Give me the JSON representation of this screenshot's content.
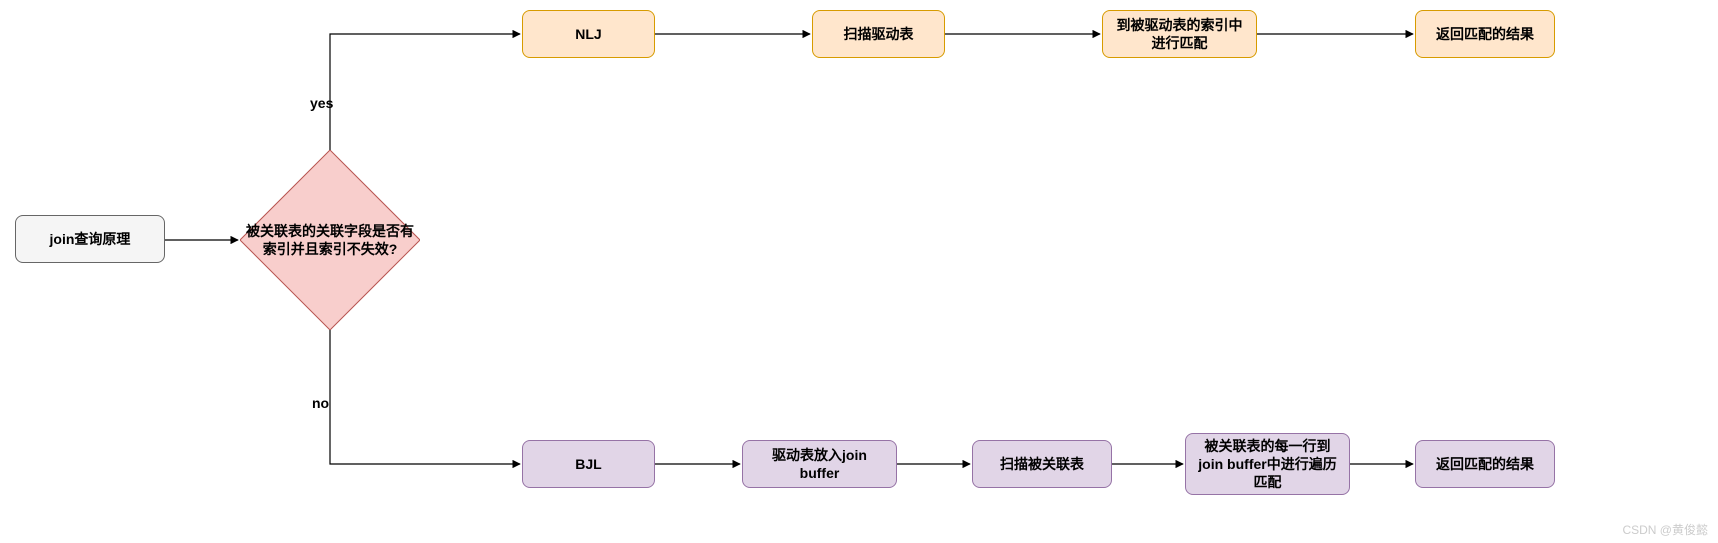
{
  "chart_data": {
    "type": "flowchart",
    "nodes": [
      {
        "id": "start",
        "type": "start",
        "label": "join查询原理"
      },
      {
        "id": "decision",
        "type": "decision",
        "label": "被关联表的关联字段是否有索引并且索引不失效?"
      },
      {
        "id": "nlj",
        "type": "process-yes",
        "label": "NLJ"
      },
      {
        "id": "scan_drive",
        "type": "process-yes",
        "label": "扫描驱动表"
      },
      {
        "id": "index_match",
        "type": "process-yes",
        "label": "到被驱动表的索引中进行匹配"
      },
      {
        "id": "return1",
        "type": "process-yes",
        "label": "返回匹配的结果"
      },
      {
        "id": "bjl",
        "type": "process-no",
        "label": "BJL"
      },
      {
        "id": "drive_buffer",
        "type": "process-no",
        "label": "驱动表放入join buffer"
      },
      {
        "id": "scan_related",
        "type": "process-no",
        "label": "扫描被关联表"
      },
      {
        "id": "buffer_match",
        "type": "process-no",
        "label": "被关联表的每一行到join buffer中进行遍历匹配"
      },
      {
        "id": "return2",
        "type": "process-no",
        "label": "返回匹配的结果"
      }
    ],
    "edges": [
      {
        "from": "start",
        "to": "decision"
      },
      {
        "from": "decision",
        "to": "nlj",
        "label": "yes"
      },
      {
        "from": "decision",
        "to": "bjl",
        "label": "no"
      },
      {
        "from": "nlj",
        "to": "scan_drive"
      },
      {
        "from": "scan_drive",
        "to": "index_match"
      },
      {
        "from": "index_match",
        "to": "return1"
      },
      {
        "from": "bjl",
        "to": "drive_buffer"
      },
      {
        "from": "drive_buffer",
        "to": "scan_related"
      },
      {
        "from": "scan_related",
        "to": "buffer_match"
      },
      {
        "from": "buffer_match",
        "to": "return2"
      }
    ]
  },
  "nodes": {
    "start": "join查询原理",
    "decision": "被关联表的关联字段是否有索引并且索引不失效?",
    "nlj": "NLJ",
    "scan_drive": "扫描驱动表",
    "index_match": "到被驱动表的索引中进行匹配",
    "return1": "返回匹配的结果",
    "bjl": "BJL",
    "drive_buffer": "驱动表放入join buffer",
    "scan_related": "扫描被关联表",
    "buffer_match": "被关联表的每一行到join buffer中进行遍历匹配",
    "return2": "返回匹配的结果"
  },
  "labels": {
    "yes": "yes",
    "no": "no"
  },
  "watermark": "CSDN @黄俊懿"
}
